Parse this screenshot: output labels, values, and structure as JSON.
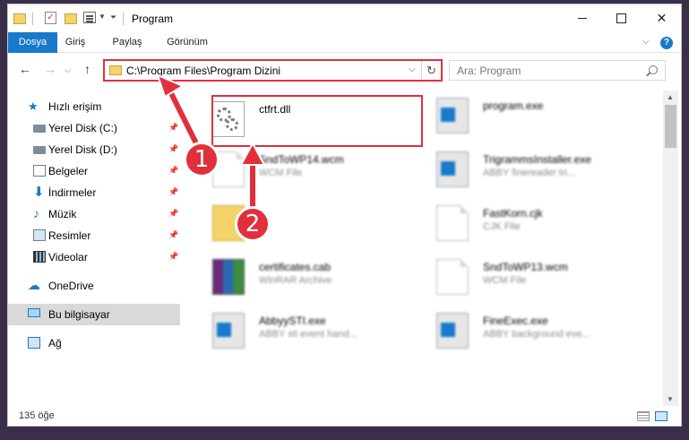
{
  "window": {
    "title": "Program",
    "minimize_label": "—",
    "close_label": "✕"
  },
  "ribbon": {
    "tabs": [
      "Dosya",
      "Giriş",
      "Paylaş",
      "Görünüm"
    ],
    "help_label": "?"
  },
  "address_bar": {
    "path": "C:\\Program Files\\Program Dizini",
    "refresh_icon": "↻",
    "dropdown_icon": "⌵"
  },
  "search": {
    "placeholder": "Ara: Program"
  },
  "sidebar": {
    "items": [
      {
        "label": "Hızlı erişim",
        "icon": "star-icon",
        "pinned": false
      },
      {
        "label": "Yerel Disk (C:)",
        "icon": "disk-icon",
        "pinned": true
      },
      {
        "label": "Yerel Disk (D:)",
        "icon": "disk-icon",
        "pinned": true
      },
      {
        "label": "Belgeler",
        "icon": "document-icon",
        "pinned": true
      },
      {
        "label": "İndirmeler",
        "icon": "download-icon",
        "pinned": true
      },
      {
        "label": "Müzik",
        "icon": "music-icon",
        "pinned": true
      },
      {
        "label": "Resimler",
        "icon": "pictures-icon",
        "pinned": true
      },
      {
        "label": "Videolar",
        "icon": "video-icon",
        "pinned": true
      },
      {
        "label": "OneDrive",
        "icon": "cloud-icon",
        "pinned": false
      },
      {
        "label": "Bu bilgisayar",
        "icon": "computer-icon",
        "pinned": false,
        "selected": true
      },
      {
        "label": "Ağ",
        "icon": "network-icon",
        "pinned": false
      }
    ]
  },
  "files": [
    {
      "name": "ctfrt.dll",
      "type": "",
      "icon": "dll-gear-icon"
    },
    {
      "name": "program.exe",
      "type": "",
      "icon": "exe-icon"
    },
    {
      "name": "SndToWP14.wcm",
      "type": "WCM File",
      "icon": "document-icon"
    },
    {
      "name": "TrigrammsInstaller.exe",
      "type": "ABBY finereader tri...",
      "icon": "exe-icon"
    },
    {
      "name": "",
      "type": "",
      "icon": "folder-icon"
    },
    {
      "name": "FastKorn.cjk",
      "type": "CJK File",
      "icon": "document-icon"
    },
    {
      "name": "certificates.cab",
      "type": "WinRAR Archive",
      "icon": "archive-icon"
    },
    {
      "name": "SndToWP13.wcm",
      "type": "WCM File",
      "icon": "document-icon"
    },
    {
      "name": "AbbyySTI.exe",
      "type": "ABBY sti event hand...",
      "icon": "exe-icon"
    },
    {
      "name": "FineExec.exe",
      "type": "ABBY background eve...",
      "icon": "exe-icon"
    }
  ],
  "status_bar": {
    "item_count": "135 öğe"
  },
  "annotations": [
    "1",
    "2"
  ],
  "colors": {
    "accent": "#1979ca",
    "highlight_red": "#e0303b"
  }
}
